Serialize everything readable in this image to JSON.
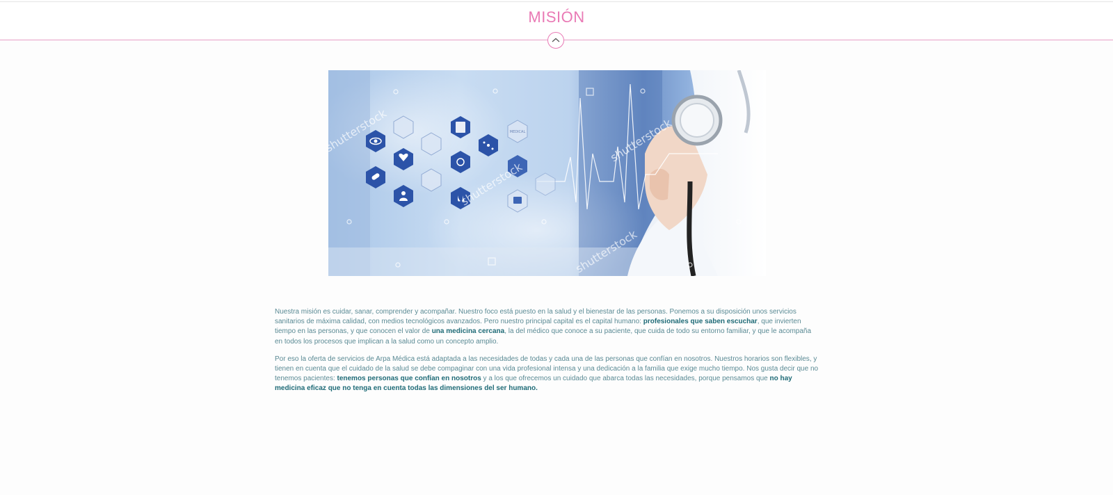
{
  "header": {
    "title": "MISIÓN",
    "collapse_icon": "chevron-up-icon",
    "accent_color": "#e97ab5"
  },
  "hero": {
    "watermark": "shutterstock",
    "icon_label": "MEDICAL"
  },
  "mission": {
    "p1_a": "Nuestra misión es cuidar, sanar, comprender y acompañar. Nuestro foco está puesto en la salud y el bienestar de las personas. Ponemos a su disposición unos servicios sanitarios de máxima calidad, con medios tecnológicos avanzados. Pero nuestro principal capital es el capital humano: ",
    "p1_b": "profesionales que saben escuchar",
    "p1_c": ", que invierten tiempo en las personas, y que conocen el valor de ",
    "p1_d": "una medicina cercana",
    "p1_e": ", la del médico que conoce a su paciente, que cuida de todo su entorno familiar, y que le acompaña en todos los procesos que implican a la salud como un concepto amplio.",
    "p2_a": "Por eso la oferta de servicios de Arpa Médica está adaptada a las necesidades de todas y cada una de las personas que confían en nosotros. Nuestros horarios son flexibles, y tienen en cuenta que el cuidado de la salud se debe compaginar con una vida profesional intensa y una dedicación a la familia que exige mucho tiempo. Nos gusta decir que no tenemos pacientes: ",
    "p2_b": "tenemos personas que confían en nosotros",
    "p2_c": " y a los que ofrecemos un cuidado que abarca todas las necesidades, porque pensamos que ",
    "p2_d": "no hay medicina eficaz que no tenga en cuenta todas las dimensiones del ser humano.",
    "text_color": "#5a8a94",
    "bold_color": "#1f6b77"
  }
}
